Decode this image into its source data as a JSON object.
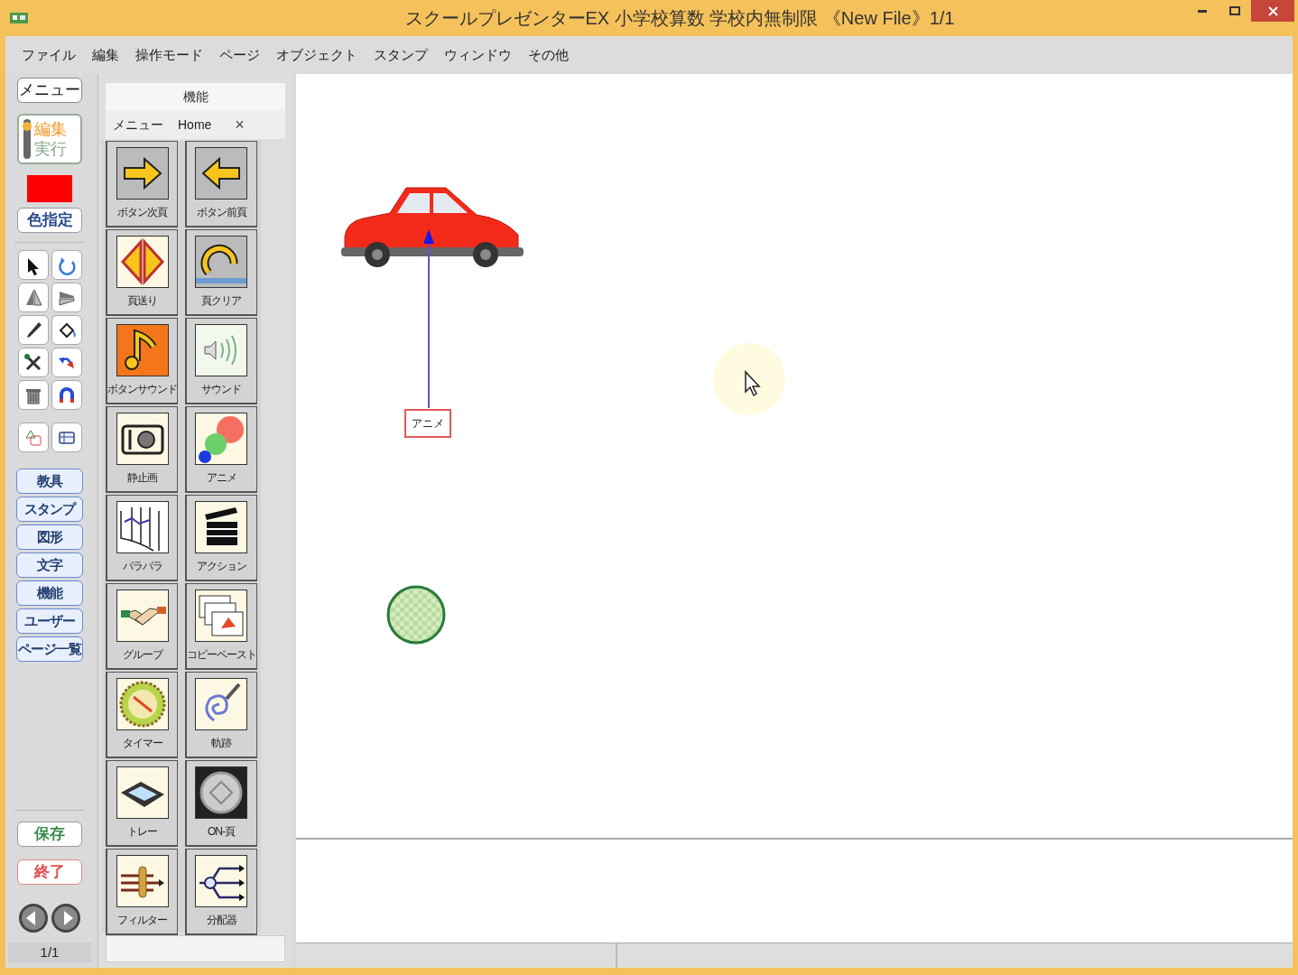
{
  "window": {
    "title": "スクールプレゼンターEX 小学校算数 学校内無制限 《New File》1/1"
  },
  "menu_bar": [
    "ファイル",
    "編集",
    "操作モード",
    "ページ",
    "オブジェクト",
    "スタンプ",
    "ウィンドウ",
    "その他"
  ],
  "left_toolbar": {
    "menu_button": "メニュー",
    "mode_switch": [
      {
        "label": "編集",
        "selected": true
      },
      {
        "label": "実行",
        "selected": false
      }
    ],
    "color_swatch": {
      "color": "#ff0000"
    },
    "color_button": "色指定",
    "categories": [
      "教具",
      "スタンプ",
      "図形",
      "文字",
      "機能",
      "ユーザー",
      "ページ一覧"
    ],
    "save_button": "保存",
    "exit_button": "終了",
    "page_indicator": "1/1"
  },
  "palette": {
    "title": "機能",
    "tabs": [
      "メニュー",
      "Home"
    ],
    "close": "×",
    "tools": [
      {
        "label": "ボタン次頁"
      },
      {
        "label": "ボタン前頁"
      },
      {
        "label": "頁送り"
      },
      {
        "label": "頁クリア"
      },
      {
        "label": "ボタンサウンド"
      },
      {
        "label": "サウンド"
      },
      {
        "label": "静止画"
      },
      {
        "label": "アニメ"
      },
      {
        "label": "パラパラ"
      },
      {
        "label": "アクション"
      },
      {
        "label": "グループ"
      },
      {
        "label": "コピーペースト"
      },
      {
        "label": "タイマー"
      },
      {
        "label": "軌跡"
      },
      {
        "label": "トレー"
      },
      {
        "label": "ON-頁"
      },
      {
        "label": "フィルター"
      },
      {
        "label": "分配器"
      }
    ]
  },
  "canvas": {
    "anime_label": "アニメ"
  }
}
